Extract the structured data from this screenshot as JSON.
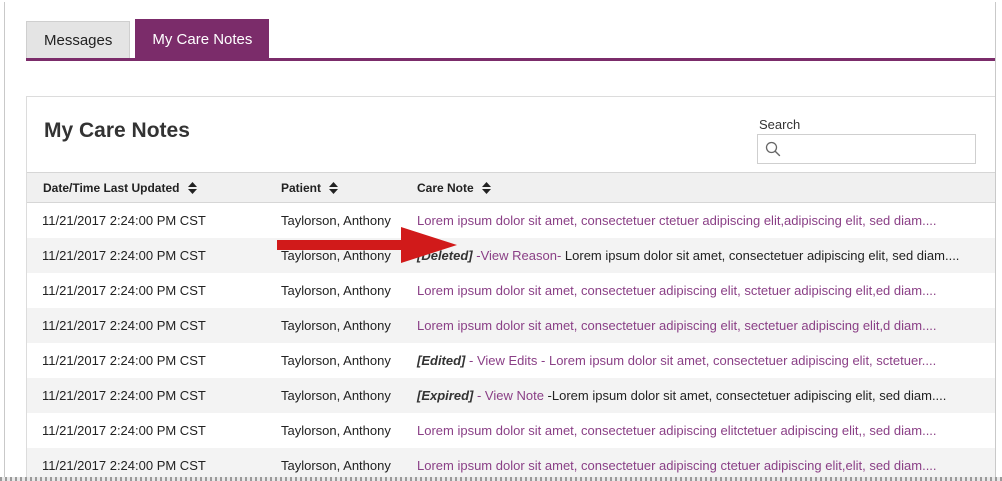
{
  "tabs": [
    {
      "label": "Messages",
      "active": false
    },
    {
      "label": "My Care Notes",
      "active": true
    }
  ],
  "panel": {
    "title": "My Care Notes"
  },
  "search": {
    "label": "Search",
    "value": ""
  },
  "table": {
    "headers": {
      "date": "Date/Time Last Updated",
      "patient": "Patient",
      "note": "Care Note"
    },
    "rows": [
      {
        "date": "11/21/2017 2:24:00 PM CST",
        "patient": "Taylorson, Anthony",
        "status": "",
        "action": "",
        "note": "Lorem ipsum dolor sit amet, consectetuer ctetuer adipiscing elit,adipiscing elit, sed diam...."
      },
      {
        "date": "11/21/2017 2:24:00 PM CST",
        "patient": "Taylorson, Anthony",
        "status": "[Deleted]",
        "action": "-View Reason-",
        "note": " Lorem ipsum dolor sit amet, consectetuer adipiscing elit, sed diam...."
      },
      {
        "date": "11/21/2017 2:24:00 PM CST",
        "patient": "Taylorson, Anthony",
        "status": "",
        "action": "",
        "note": "Lorem ipsum dolor sit amet, consectetuer adipiscing elit, sctetuer adipiscing elit,ed diam...."
      },
      {
        "date": "11/21/2017 2:24:00 PM CST",
        "patient": "Taylorson, Anthony",
        "status": "",
        "action": "",
        "note": "Lorem ipsum dolor sit amet, consectetuer adipiscing elit, sectetuer adipiscing elit,d diam...."
      },
      {
        "date": "11/21/2017 2:24:00 PM CST",
        "patient": "Taylorson, Anthony",
        "status": "[Edited]",
        "action": " - View Edits - ",
        "note": "Lorem ipsum dolor sit amet, consectetuer adipiscing elit, sctetuer...."
      },
      {
        "date": "11/21/2017 2:24:00 PM CST",
        "patient": "Taylorson, Anthony",
        "status": "[Expired]",
        "action": " - View Note ",
        "note": "-Lorem ipsum dolor sit amet, consectetuer adipiscing elit, sed diam...."
      },
      {
        "date": "11/21/2017 2:24:00 PM CST",
        "patient": "Taylorson, Anthony",
        "status": "",
        "action": "",
        "note": "Lorem ipsum dolor sit amet, consectetuer adipiscing elitctetuer adipiscing elit,, sed diam...."
      },
      {
        "date": "11/21/2017 2:24:00 PM CST",
        "patient": "Taylorson, Anthony",
        "status": "",
        "action": "",
        "note": "Lorem ipsum dolor sit amet, consectetuer adipiscing ctetuer adipiscing elit,elit, sed diam...."
      }
    ]
  },
  "colors": {
    "accent": "#7b2c6a",
    "link": "#8a3f86",
    "arrow": "#d11a1a"
  },
  "icons": {
    "search": "search-icon",
    "sort": "sort-icon",
    "annotation": "red-arrow-icon"
  }
}
